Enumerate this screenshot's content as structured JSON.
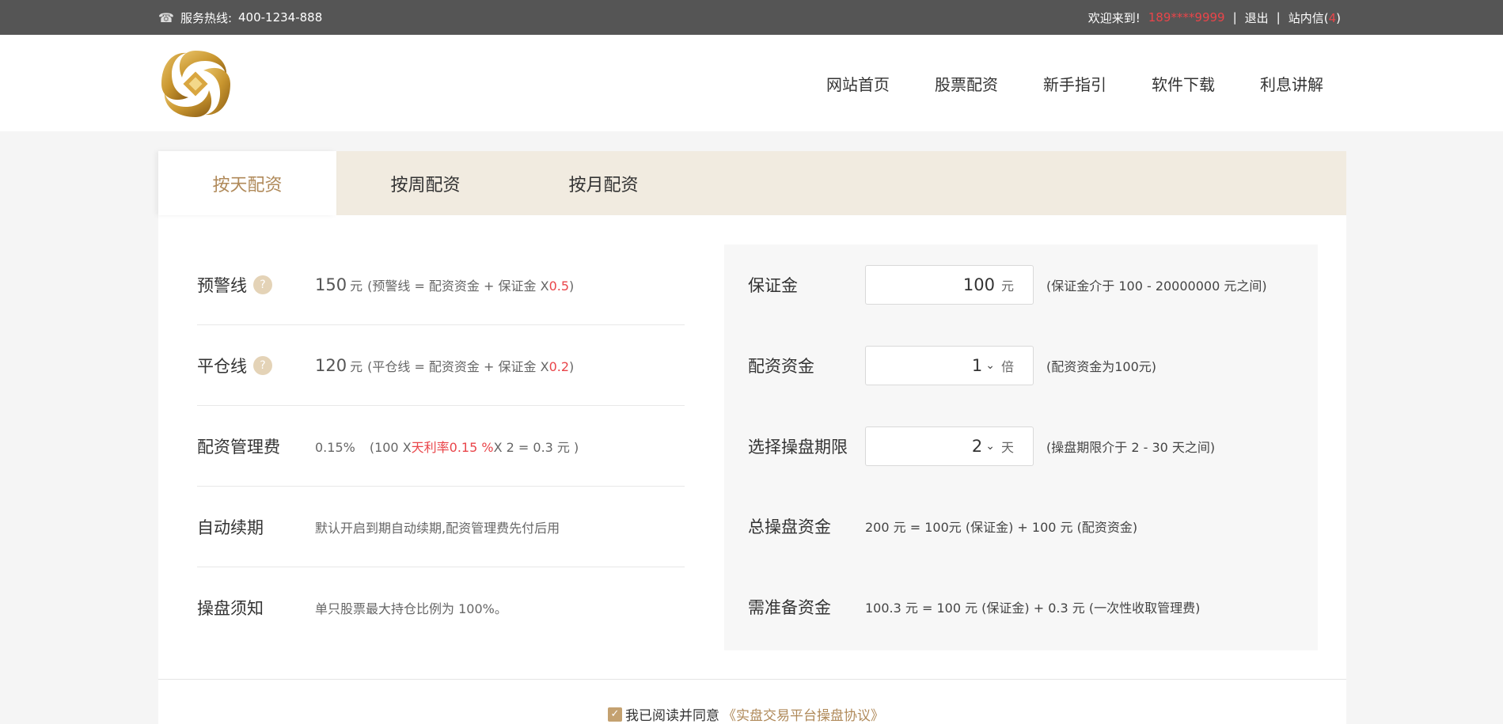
{
  "topbar": {
    "hotline_label": "服务热线:",
    "hotline_number": "400-1234-888",
    "welcome": "欢迎来到!",
    "user": "189****9999",
    "logout": "退出",
    "messages_label": "站内信",
    "messages_count": "4",
    "separator": "|"
  },
  "nav": {
    "items": [
      "网站首页",
      "股票配资",
      "新手指引",
      "软件下载",
      "利息讲解"
    ]
  },
  "tabs": [
    "按天配资",
    "按周配资",
    "按月配资"
  ],
  "info": {
    "warning": {
      "label": "预警线",
      "value": "150",
      "unit": "元",
      "formula": "(预警线 = 配资资金 + 保证金 X ",
      "factor": "0.5",
      "close": ")"
    },
    "liquidation": {
      "label": "平仓线",
      "value": "120",
      "unit": "元",
      "formula": "(平仓线 = 配资资金 + 保证金 X ",
      "factor": "0.2",
      "close": ")"
    },
    "fee": {
      "label": "配资管理费",
      "rate": "0.15%",
      "formula_start": "(100 X ",
      "rate_highlight": "天利率0.15 %",
      "formula_end": " X 2 = 0.3 元 )"
    },
    "renew": {
      "label": "自动续期",
      "text": "默认开启到期自动续期,配资管理费先付后用"
    },
    "notice": {
      "label": "操盘须知",
      "text": "单只股票最大持仓比例为 100%。"
    }
  },
  "form": {
    "deposit": {
      "label": "保证金",
      "value": "100",
      "unit": "元",
      "hint": "(保证金介于 100 - 20000000 元之间)"
    },
    "leverage": {
      "label": "配资资金",
      "value": "1",
      "unit": "倍",
      "hint": "(配资资金为100元)"
    },
    "period": {
      "label": "选择操盘期限",
      "value": "2",
      "unit": "天",
      "hint": "(操盘期限介于 2 - 30 天之间)"
    },
    "total": {
      "label": "总操盘资金",
      "text": "200 元 = 100元 (保证金) + 100 元 (配资资金)"
    },
    "required": {
      "label": "需准备资金",
      "text": "100.3 元 = 100 元 (保证金) + 0.3 元 (一次性收取管理费)"
    }
  },
  "agreement": {
    "text": "我已阅读并同意",
    "link": "《实盘交易平台操盘协议》",
    "checked": true
  },
  "colors": {
    "accent": "#b08a5a",
    "highlight": "#e9454a",
    "topbar": "#555555",
    "tab_bar": "#f1ebe0"
  }
}
